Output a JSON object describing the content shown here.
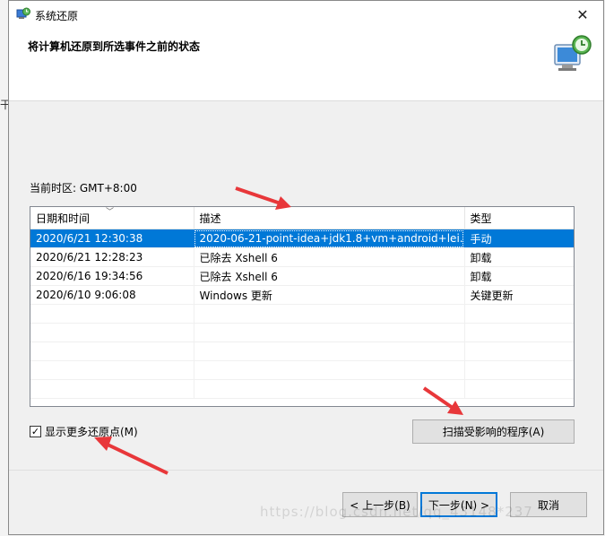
{
  "window": {
    "title": "系统还原",
    "close_glyph": "✕",
    "header_title": "将计算机还原到所选事件之前的状态"
  },
  "behind_window_glyph": "干",
  "timezone_text": "当前时区: GMT+8:00",
  "table": {
    "columns": [
      "日期和时间",
      "描述",
      "类型"
    ],
    "rows": [
      {
        "date": "2020/6/21 12:30:38",
        "desc": "2020-06-21-point-idea+jdk1.8+vm+android+lei...",
        "type": "手动",
        "selected": true
      },
      {
        "date": "2020/6/21 12:28:23",
        "desc": "已除去 Xshell 6",
        "type": "卸载",
        "selected": false
      },
      {
        "date": "2020/6/16 19:34:56",
        "desc": "已除去 Xshell 6",
        "type": "卸载",
        "selected": false
      },
      {
        "date": "2020/6/10 9:06:08",
        "desc": "Windows 更新",
        "type": "关键更新",
        "selected": false
      }
    ]
  },
  "show_more": {
    "label": "显示更多还原点(M)",
    "checked": true,
    "check_glyph": "✓"
  },
  "scan_button_label": "扫描受影响的程序(A)",
  "buttons": {
    "prev": "< 上一步(B)",
    "next": "下一步(N) >",
    "cancel": "取消"
  },
  "watermark": "https://blog.csdn.net/qq_43148*237",
  "colors": {
    "selection": "#0078d7",
    "annotation_arrow": "#e8373a"
  }
}
